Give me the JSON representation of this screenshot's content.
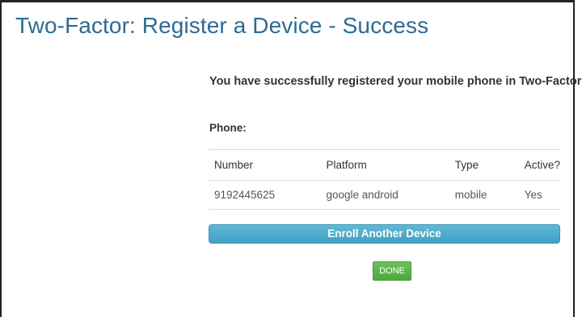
{
  "page": {
    "title": "Two-Factor: Register a Device - Success"
  },
  "main": {
    "success_message": "You have successfully registered your mobile phone in Two-Factor!",
    "phone_label": "Phone:"
  },
  "devices_table": {
    "headers": [
      "Number",
      "Platform",
      "Type",
      "Active?"
    ],
    "rows": [
      [
        "9192445625",
        "google android",
        "mobile",
        "Yes"
      ]
    ]
  },
  "actions": {
    "enroll_label": "Enroll Another Device",
    "done_label": "DONE"
  },
  "colors": {
    "title": "#2c6b93",
    "enroll_button": "#4aa8cb",
    "done_button": "#5bb54b"
  }
}
